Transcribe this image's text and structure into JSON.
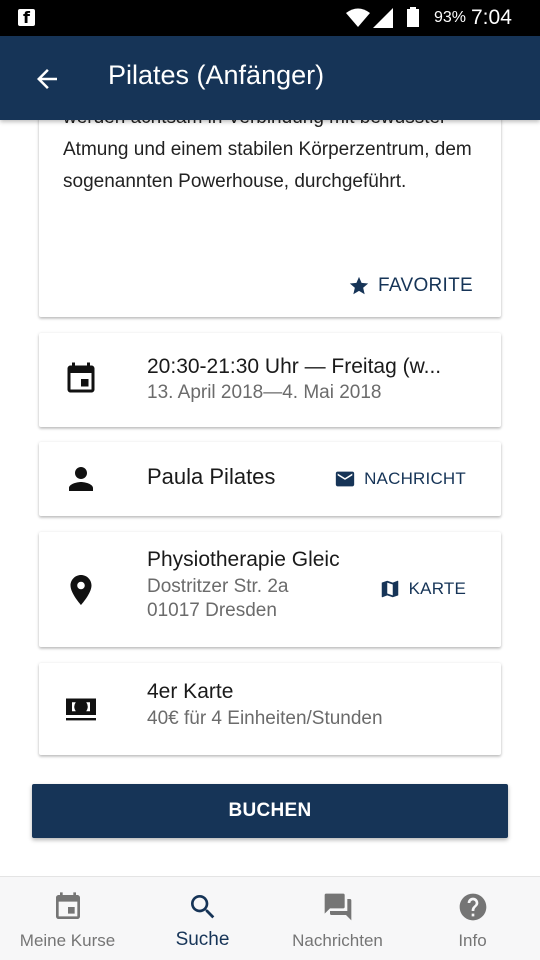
{
  "status_bar": {
    "notification_app": "facebook",
    "battery_percent": "93%",
    "time": "7:04"
  },
  "app_bar": {
    "back_icon": "arrow-back-icon",
    "title": "Pilates (Anfänger)"
  },
  "description": {
    "lines_text": "werden achtsam in Verbindung mit bewusster Atmung und einem stabilen Körperzentrum, dem sogenannten Powerhouse, durchgeführt.",
    "favorite_label": "FAVORITE",
    "favorite_icon": "star-icon"
  },
  "schedule": {
    "icon": "calendar-icon",
    "time": "20:30-21:30 Uhr — Freitag (w...",
    "date_range": "13. April 2018—4. Mai 2018"
  },
  "teacher": {
    "icon": "person-icon",
    "name": "Paula Pilates",
    "message_label": "NACHRICHT",
    "message_icon": "mail-icon"
  },
  "location": {
    "icon": "location-pin-icon",
    "name": "Physiotherapie Gleic",
    "street": "Dostritzer Str. 2a",
    "city": "01017 Dresden",
    "map_label": "KARTE",
    "map_icon": "map-icon"
  },
  "price": {
    "icon": "money-icon",
    "title": "4er Karte",
    "detail": "40€ für 4 Einheiten/Stunden"
  },
  "book_button": "BUCHEN",
  "bottom_nav": {
    "items": [
      {
        "label": "Meine Kurse",
        "icon": "calendar-icon",
        "active": false
      },
      {
        "label": "Suche",
        "icon": "search-icon",
        "active": true
      },
      {
        "label": "Nachrichten",
        "icon": "chat-icon",
        "active": false
      },
      {
        "label": "Info",
        "icon": "help-icon",
        "active": false
      }
    ]
  },
  "colors": {
    "primary": "#163457",
    "secondary_text": "#6b6b6b",
    "nav_inactive": "#757575"
  }
}
